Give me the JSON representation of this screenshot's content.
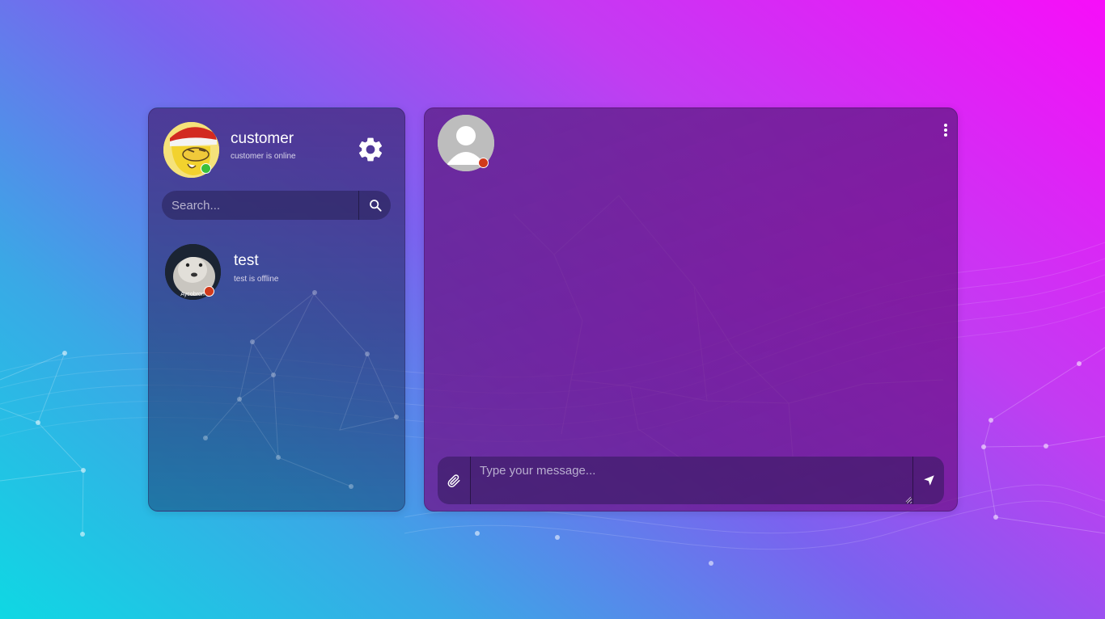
{
  "me": {
    "name": "customer",
    "status_text": "customer is online",
    "status_color": "#3bbf3b"
  },
  "search": {
    "placeholder": "Search..."
  },
  "contacts": [
    {
      "name": "test",
      "status_text": "test is offline",
      "avatar_caption": "Aycobron",
      "status_color": "#d13a1c"
    }
  ],
  "chat": {
    "input_placeholder": "Type your message..."
  },
  "icons": {
    "settings": "gear-icon",
    "search": "search-icon",
    "menu": "more-vertical-icon",
    "attach": "paperclip-icon",
    "send": "send-icon"
  }
}
